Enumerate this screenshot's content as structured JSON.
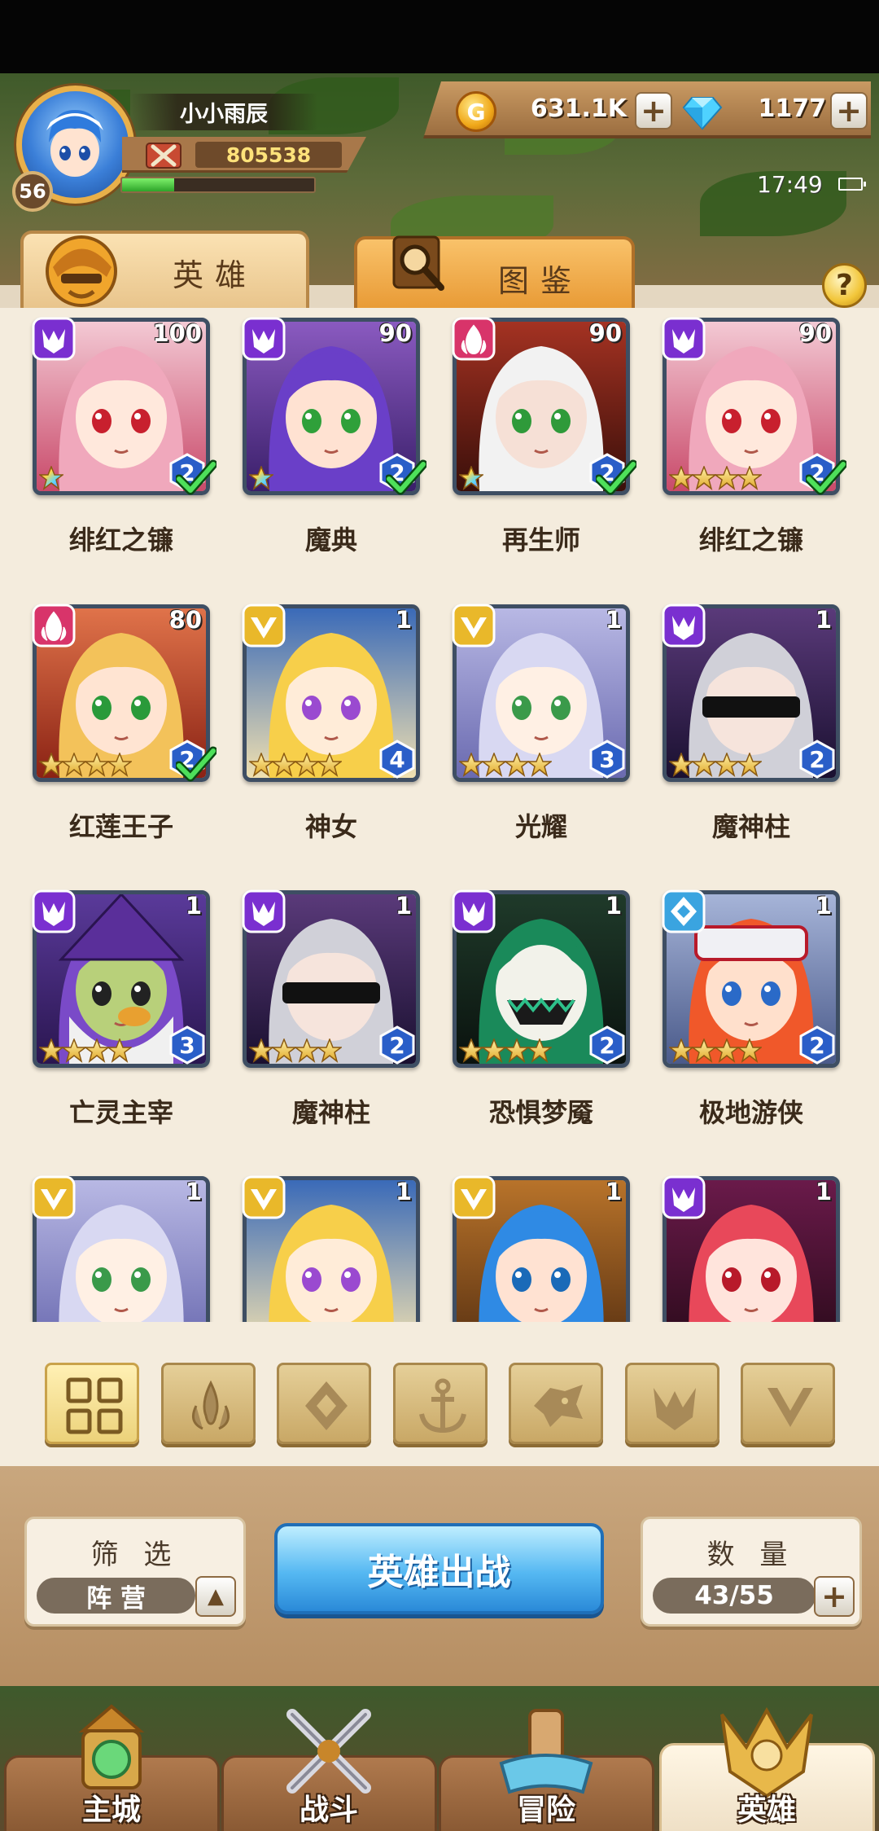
{
  "player": {
    "name": "小小雨辰",
    "level": "56",
    "power": "805538",
    "exp_fraction": 0.27
  },
  "resources": {
    "gold": "631.1K",
    "gems": "1177"
  },
  "status": {
    "time": "17:49"
  },
  "tabs": [
    {
      "label": "英雄",
      "active": true
    },
    {
      "label": "图鉴",
      "active": false
    }
  ],
  "help_label": "?",
  "heroes": [
    {
      "name": "绯红之镰",
      "level": "100",
      "faction": "dark",
      "stars": 1,
      "star_type": "rainbow",
      "count": "2",
      "checked": true,
      "portrait": "pink-hair"
    },
    {
      "name": "魔典",
      "level": "90",
      "faction": "dark",
      "stars": 1,
      "star_type": "rainbow",
      "count": "2",
      "checked": true,
      "portrait": "purple-hair"
    },
    {
      "name": "再生师",
      "level": "90",
      "faction": "fire",
      "stars": 1,
      "star_type": "rainbow",
      "count": "2",
      "checked": true,
      "portrait": "white-hair"
    },
    {
      "name": "绯红之镰",
      "level": "90",
      "faction": "dark",
      "stars": 4,
      "star_type": "gold",
      "count": "2",
      "checked": true,
      "portrait": "pink-hair"
    },
    {
      "name": "红莲王子",
      "level": "80",
      "faction": "fire",
      "stars": 4,
      "star_type": "gold",
      "count": "2",
      "checked": true,
      "portrait": "blond-prince"
    },
    {
      "name": "神女",
      "level": "1",
      "faction": "light",
      "stars": 4,
      "star_type": "gold",
      "count": "4",
      "checked": false,
      "portrait": "goddess"
    },
    {
      "name": "光耀",
      "level": "1",
      "faction": "light",
      "stars": 4,
      "star_type": "gold",
      "count": "3",
      "checked": false,
      "portrait": "silver-hair"
    },
    {
      "name": "魔神柱",
      "level": "1",
      "faction": "dark",
      "stars": 4,
      "star_type": "gold",
      "count": "2",
      "checked": false,
      "portrait": "blindfold"
    },
    {
      "name": "亡灵主宰",
      "level": "1",
      "faction": "dark",
      "stars": 4,
      "star_type": "gold",
      "count": "3",
      "checked": false,
      "portrait": "wizard"
    },
    {
      "name": "魔神柱",
      "level": "1",
      "faction": "dark",
      "stars": 4,
      "star_type": "gold",
      "count": "2",
      "checked": false,
      "portrait": "blindfold"
    },
    {
      "name": "恐惧梦魇",
      "level": "1",
      "faction": "dark",
      "stars": 4,
      "star_type": "gold",
      "count": "2",
      "checked": false,
      "portrait": "jester"
    },
    {
      "name": "极地游侠",
      "level": "1",
      "faction": "water",
      "stars": 4,
      "star_type": "gold",
      "count": "2",
      "checked": false,
      "portrait": "ranger"
    },
    {
      "name": "",
      "level": "1",
      "faction": "light",
      "stars": 0,
      "star_type": "gold",
      "count": "",
      "checked": false,
      "portrait": "silver-hair"
    },
    {
      "name": "",
      "level": "1",
      "faction": "light",
      "stars": 0,
      "star_type": "gold",
      "count": "",
      "checked": false,
      "portrait": "goddess"
    },
    {
      "name": "",
      "level": "1",
      "faction": "light",
      "stars": 0,
      "star_type": "gold",
      "count": "",
      "checked": false,
      "portrait": "blue-hair"
    },
    {
      "name": "",
      "level": "1",
      "faction": "dark",
      "stars": 0,
      "star_type": "gold",
      "count": "",
      "checked": false,
      "portrait": "demon-girl"
    }
  ],
  "faction_filters": [
    {
      "icon": "grid-icon",
      "active": true
    },
    {
      "icon": "fire-faction-icon",
      "active": false
    },
    {
      "icon": "water-faction-icon",
      "active": false
    },
    {
      "icon": "anchor-icon",
      "active": false
    },
    {
      "icon": "beast-faction-icon",
      "active": false
    },
    {
      "icon": "dark-faction-icon",
      "active": false
    },
    {
      "icon": "light-faction-icon",
      "active": false
    }
  ],
  "filter": {
    "title": "筛 选",
    "value": "阵 营"
  },
  "deploy_label": "英雄出战",
  "capacity": {
    "title": "数 量",
    "value": "43/55"
  },
  "nav": [
    {
      "label": "主城",
      "icon": "castle-icon",
      "active": false
    },
    {
      "label": "战斗",
      "icon": "crossed-swords-icon",
      "active": false
    },
    {
      "label": "冒险",
      "icon": "map-icon",
      "active": false
    },
    {
      "label": "英雄",
      "icon": "hero-emblem-icon",
      "active": true
    }
  ],
  "colors": {
    "dark": "#7a2fd0",
    "fire": "#d8346a",
    "light": "#e9b82a",
    "water": "#3aa4e0",
    "accent_blue": "#55b8f2"
  }
}
